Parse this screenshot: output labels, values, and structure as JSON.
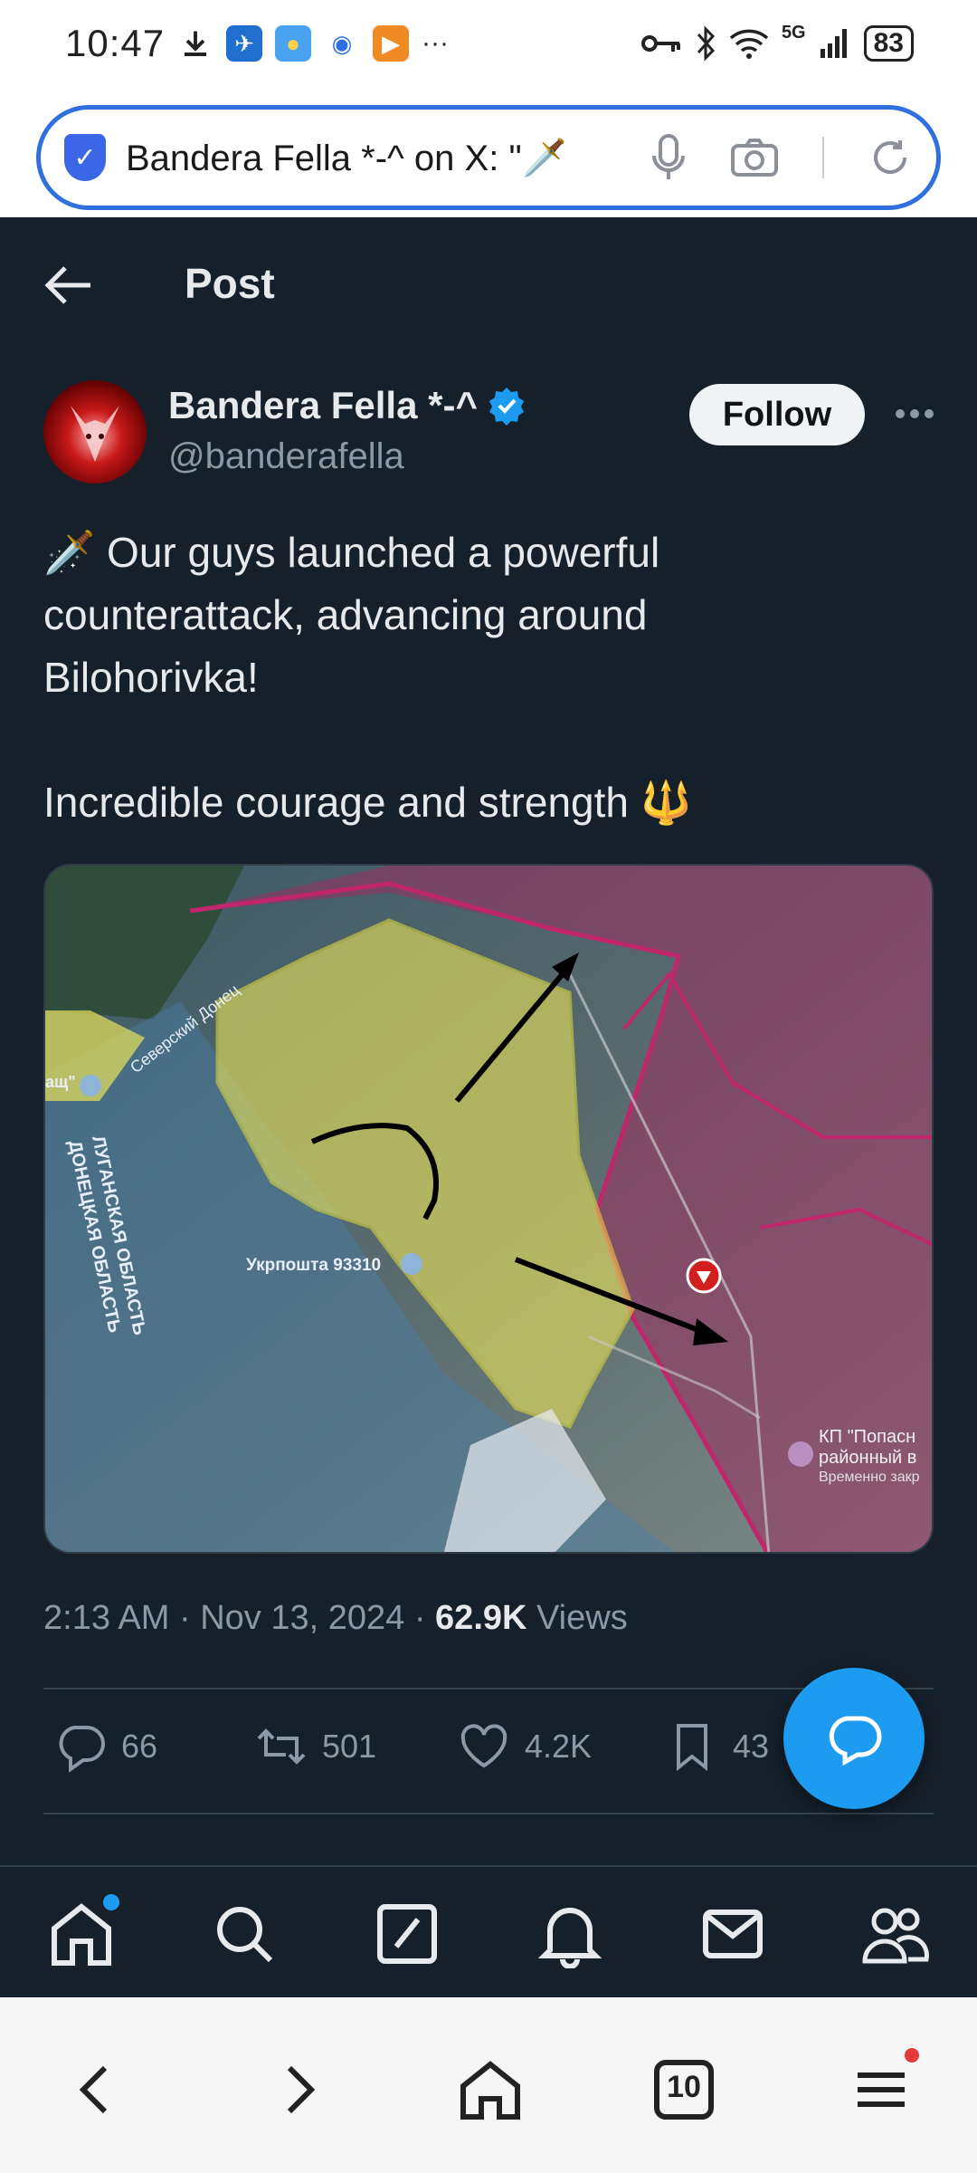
{
  "status_bar": {
    "time": "10:47",
    "battery": "83",
    "network": "5G",
    "more": "···"
  },
  "url_bar": {
    "text": "Bandera Fella *-^ on X: \"🗡️"
  },
  "header": {
    "title": "Post"
  },
  "author": {
    "name": "Bandera Fella *-^",
    "handle": "@banderafella",
    "follow_label": "Follow"
  },
  "post": {
    "lines": [
      "🗡️ Our guys launched a powerful",
      "counterattack, advancing around",
      "Bilohorivka!",
      "",
      "Incredible courage and strength 🔱"
    ]
  },
  "map_labels": {
    "river": "Северский Донец",
    "region1": "ЛУГАНСКАЯ ОБЛАСТЬ",
    "region2": "ДОНЕЦКАЯ ОБЛАСТЬ",
    "postoffice": "Укрпошта 93310",
    "kp_line1": "КП \"Попасн",
    "kp_line2": "районный в",
    "kp_line3": "Временно закр",
    "left_cut": "ащ\""
  },
  "meta": {
    "time": "2:13 AM",
    "date": "Nov 13, 2024",
    "views_count": "62.9K",
    "views_label": "Views",
    "sep": "·"
  },
  "actions": {
    "replies": "66",
    "reposts": "501",
    "likes": "4.2K",
    "bookmarks": "43"
  },
  "browser_nav": {
    "tabs_count": "10"
  },
  "colors": {
    "background": "#15202b",
    "accent": "#1d9bf0",
    "text": "#e7e9ea",
    "muted": "#8b98a5"
  }
}
